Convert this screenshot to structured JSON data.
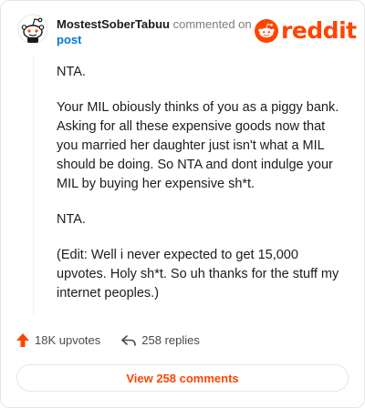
{
  "header": {
    "username": "MostestSoberTabuu",
    "commented_text": "commented on",
    "post_link": "post",
    "logo_text": "reddit"
  },
  "comment": {
    "paragraphs": [
      "NTA.",
      "Your MIL obiously thinks of you as a piggy bank. Asking for all these expensive goods now that you married her daughter just isn't what a MIL should be doing. So NTA and dont indulge your MIL by buying her expensive sh*t.",
      "NTA.",
      "(Edit: Well i never expected to get 15,000 upvotes. Holy sh*t. So uh thanks for the stuff my internet peoples.)"
    ]
  },
  "footer": {
    "upvotes": "18K upvotes",
    "replies": "258 replies",
    "view_comments": "View 258 comments"
  },
  "colors": {
    "brand": "#ff4500",
    "link": "#0079d3"
  },
  "icons": [
    "snoo-avatar-icon",
    "reddit-logo-icon",
    "upvote-arrow-icon",
    "reply-arrow-icon"
  ]
}
